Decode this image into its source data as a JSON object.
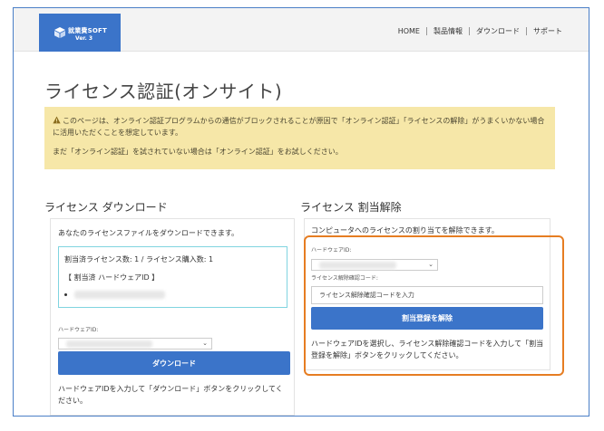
{
  "header": {
    "logo_name": "就業費SOFT",
    "logo_version": "Ver. 3",
    "nav": [
      "HOME",
      "製品情報",
      "ダウンロード",
      "サポート"
    ]
  },
  "page": {
    "title": "ライセンス認証(オンサイト)"
  },
  "alert": {
    "line1": "このページは、オンライン認証プログラムからの通信がブロックされることが原因で「オンライン認証」「ライセンスの解除」がうまくいかない場合に活用いただくことを想定しています。",
    "line2": "まだ「オンライン認証」を試されていない場合は「オンライン認証」をお試しください。"
  },
  "download": {
    "title": "ライセンス ダウンロード",
    "desc": "あなたのライセンスファイルをダウンロードできます。",
    "license_counts": "割当済ライセンス数: 1 / ライセンス購入数: 1",
    "assigned_hw": "【 割当済 ハードウェアID 】",
    "hw_label": "ハードウェアID:",
    "button": "ダウンロード",
    "help": "ハードウェアIDを入力して「ダウンロード」ボタンをクリックしてください。"
  },
  "release": {
    "title": "ライセンス 割当解除",
    "desc": "コンピュータへのライセンスの割り当てを解除できます。",
    "hw_label": "ハードウェアID:",
    "code_label": "ライセンス解除確認コード:",
    "code_placeholder": "ライセンス解除確認コードを入力",
    "button": "割当登録を解除",
    "help": "ハードウェアIDを選択し、ライセンス解除確認コードを入力して「割当登録を解除」ボタンをクリックしてください。"
  },
  "colors": {
    "accent": "#3b74c9",
    "alert_bg": "#f6e7a8",
    "highlight": "#e67d22"
  }
}
